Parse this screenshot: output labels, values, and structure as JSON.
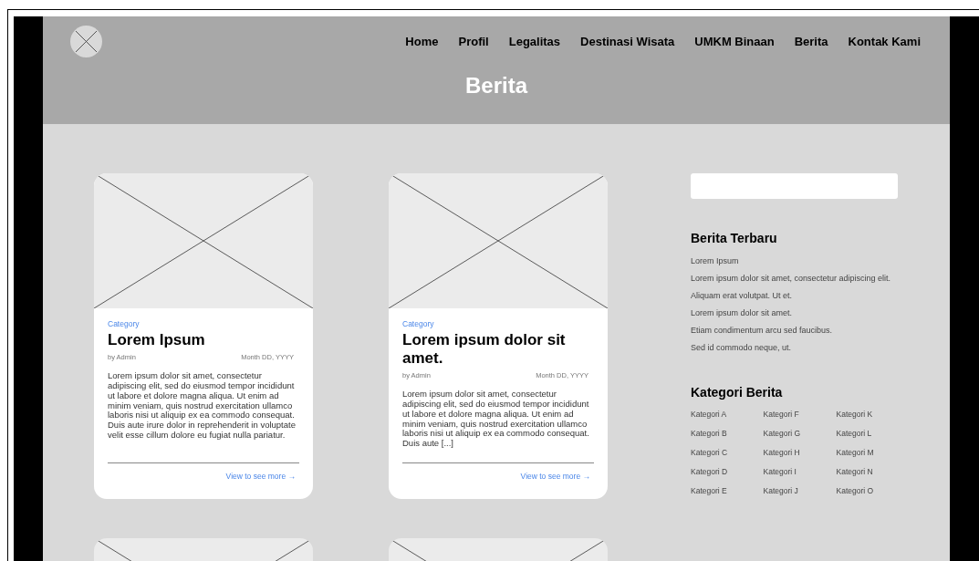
{
  "nav": {
    "items": [
      "Home",
      "Profil",
      "Legalitas",
      "Destinasi Wisata",
      "UMKM Binaan",
      "Berita",
      "Kontak Kami"
    ]
  },
  "page_title": "Berita",
  "posts": [
    {
      "kind": "full",
      "category": "Category",
      "title": "Lorem Ipsum",
      "author": "by Admin",
      "date": "Month DD, YYYY",
      "excerpt": "Lorem ipsum dolor sit amet, consectetur adipiscing elit, sed do eiusmod tempor incididunt ut labore et dolore magna aliqua. Ut enim ad minim veniam, quis nostrud exercitation ullamco laboris nisi ut aliquip ex ea commodo consequat. Duis aute irure dolor in reprehenderit in voluptate velit esse cillum dolore eu fugiat nulla pariatur.",
      "link": "View to see more →"
    },
    {
      "kind": "full",
      "category": "Category",
      "title": "Lorem ipsum dolor sit amet.",
      "author": "by Admin",
      "date": "Month DD, YYYY",
      "excerpt": "Lorem ipsum dolor sit amet, consectetur adipiscing elit, sed do eiusmod tempor incididunt ut labore et dolore magna aliqua. Ut enim ad minim veniam, quis nostrud exercitation ullamco laboris nisi ut aliquip ex ea commodo consequat. Duis aute [...]",
      "link": "View to see more →"
    },
    {
      "kind": "image_only"
    },
    {
      "kind": "image_only"
    }
  ],
  "sidebar": {
    "latest": {
      "title": "Berita Terbaru",
      "items": [
        "Lorem Ipsum",
        "Lorem ipsum dolor sit amet, consectetur adipiscing elit.",
        "Aliquam erat volutpat. Ut et.",
        "Lorem ipsum dolor sit amet.",
        "Etiam condimentum arcu sed faucibus.",
        "Sed id commodo neque, ut."
      ]
    },
    "categories": {
      "title": "Kategori Berita",
      "items": [
        "Kategori A",
        "Kategori B",
        "Kategori C",
        "Kategori D",
        "Kategori E",
        "Kategori F",
        "Kategori G",
        "Kategori H",
        "Kategori I",
        "Kategori J",
        "Kategori K",
        "Kategori L",
        "Kategori M",
        "Kategori N",
        "Kategori O"
      ]
    }
  }
}
